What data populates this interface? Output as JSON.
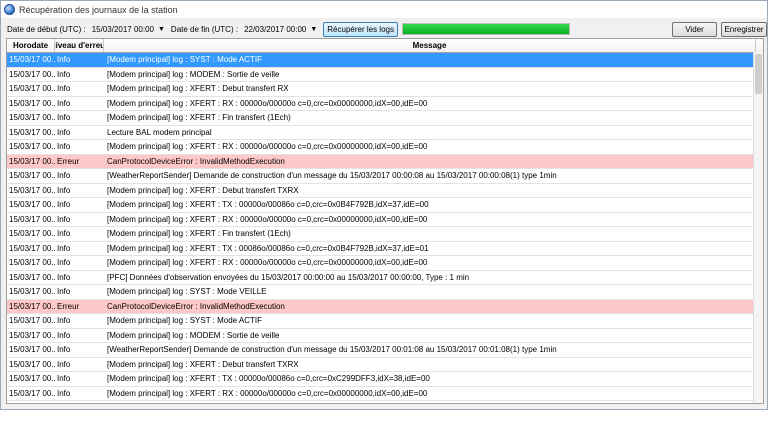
{
  "window": {
    "title": "Récupération des journaux de la station"
  },
  "toolbar": {
    "start_label": "Date de début (UTC) :",
    "start_value": "15/03/2017 00:00",
    "end_label": "Date de fin (UTC) :",
    "end_value": "22/03/2017 00:00",
    "fetch_label": "Récupérer les logs",
    "progress": 1.0,
    "progress_color": "#06b025",
    "clear_label": "Vider",
    "save_label": "Enregistrer"
  },
  "table": {
    "columns": [
      "Horodate",
      "Niveau d'erreur",
      "Message"
    ],
    "rows": [
      {
        "time": "15/03/17 00...",
        "level": "Info",
        "msg": "[Modem principal] log : SYST : Mode ACTIF",
        "state": "selected"
      },
      {
        "time": "15/03/17 00...",
        "level": "Info",
        "msg": "[Modem principal] log : MODEM : Sortie de veille",
        "state": ""
      },
      {
        "time": "15/03/17 00...",
        "level": "Info",
        "msg": "[Modem principal] log : XFERT : Debut transfert RX",
        "state": ""
      },
      {
        "time": "15/03/17 00...",
        "level": "Info",
        "msg": "[Modem principal] log : XFERT : RX : 00000o/00000o c=0,crc=0x00000000,idX=00,idE=00",
        "state": ""
      },
      {
        "time": "15/03/17 00...",
        "level": "Info",
        "msg": "[Modem principal] log : XFERT : Fin transfert (1Ech)",
        "state": ""
      },
      {
        "time": "15/03/17 00...",
        "level": "Info",
        "msg": "Lecture BAL modem principal",
        "state": ""
      },
      {
        "time": "15/03/17 00...",
        "level": "Info",
        "msg": "[Modem principal] log : XFERT : RX : 00000o/00000o c=0,crc=0x00000000,idX=00,idE=00",
        "state": ""
      },
      {
        "time": "15/03/17 00...",
        "level": "Erreur",
        "msg": "CanProtocolDeviceError : InvalidMethodExecution",
        "state": "error"
      },
      {
        "time": "15/03/17 00...",
        "level": "Info",
        "msg": "[WeatherReportSender] Demande de construction d'un message du 15/03/2017   00:00:08 au 15/03/2017   00:00:08(1) type 1min",
        "state": ""
      },
      {
        "time": "15/03/17 00...",
        "level": "Info",
        "msg": "[Modem principal] log : XFERT : Debut transfert TXRX",
        "state": ""
      },
      {
        "time": "15/03/17 00...",
        "level": "Info",
        "msg": "[Modem principal] log : XFERT : TX : 00000o/00086o c=0,crc=0x0B4F792B,idX=37,idE=00",
        "state": ""
      },
      {
        "time": "15/03/17 00...",
        "level": "Info",
        "msg": "[Modem principal] log : XFERT : RX : 00000o/00000o c=0,crc=0x00000000,idX=00,idE=00",
        "state": ""
      },
      {
        "time": "15/03/17 00...",
        "level": "Info",
        "msg": "[Modem principal] log : XFERT : Fin transfert (1Ech)",
        "state": ""
      },
      {
        "time": "15/03/17 00...",
        "level": "Info",
        "msg": "[Modem principal] log : XFERT : TX : 00086o/00086o c=0,crc=0x0B4F792B,idX=37,idE=01",
        "state": ""
      },
      {
        "time": "15/03/17 00...",
        "level": "Info",
        "msg": "[Modem principal] log : XFERT : RX : 00000o/00000o c=0,crc=0x00000000,idX=00,idE=00",
        "state": ""
      },
      {
        "time": "15/03/17 00...",
        "level": "Info",
        "msg": "[PFC] Données d'observation envoyées du 15/03/2017   00:00:00 au 15/03/2017   00:00:00, Type : 1 min",
        "state": ""
      },
      {
        "time": "15/03/17 00...",
        "level": "Info",
        "msg": "[Modem principal] log : SYST : Mode VEILLE",
        "state": ""
      },
      {
        "time": "15/03/17 00...",
        "level": "Erreur",
        "msg": "CanProtocolDeviceError : InvalidMethodExecution",
        "state": "error"
      },
      {
        "time": "15/03/17 00...",
        "level": "Info",
        "msg": "[Modem principal] log : SYST : Mode ACTIF",
        "state": ""
      },
      {
        "time": "15/03/17 00...",
        "level": "Info",
        "msg": "[Modem principal] log : MODEM : Sortie de veille",
        "state": ""
      },
      {
        "time": "15/03/17 00...",
        "level": "Info",
        "msg": "[WeatherReportSender] Demande de construction d'un message du 15/03/2017   00:01:08 au 15/03/2017   00:01:08(1) type 1min",
        "state": ""
      },
      {
        "time": "15/03/17 00...",
        "level": "Info",
        "msg": "[Modem principal] log : XFERT : Debut transfert TXRX",
        "state": ""
      },
      {
        "time": "15/03/17 00...",
        "level": "Info",
        "msg": "[Modem principal] log : XFERT : TX : 00000o/00086o c=0,crc=0xC299DFF3,idX=38,idE=00",
        "state": ""
      },
      {
        "time": "15/03/17 00...",
        "level": "Info",
        "msg": "[Modem principal] log : XFERT : RX : 00000o/00000o c=0,crc=0x00000000,idX=00,idE=00",
        "state": ""
      }
    ]
  }
}
